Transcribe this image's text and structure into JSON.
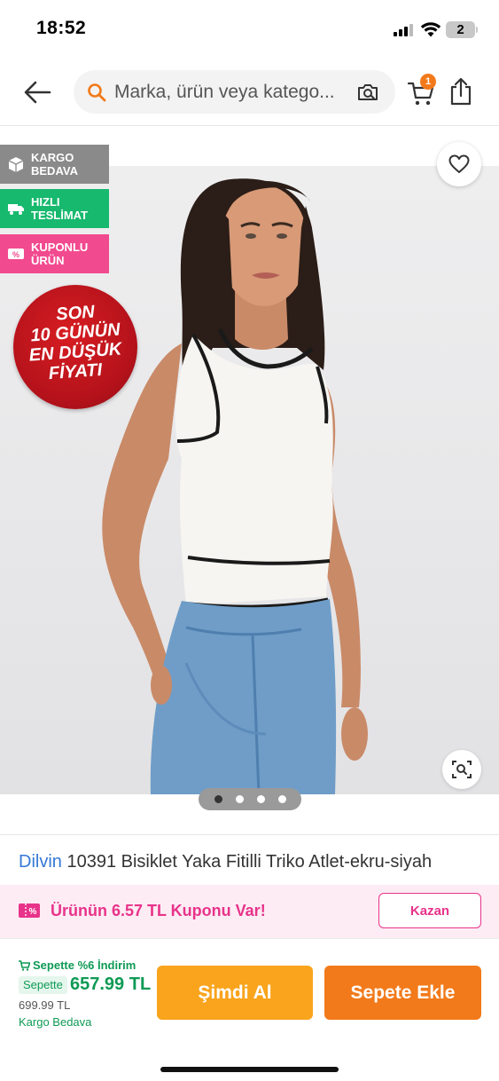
{
  "status_bar": {
    "time": "18:52",
    "battery": "2"
  },
  "header": {
    "search_placeholder": "Marka, ürün veya katego...",
    "cart_count": "1",
    "icons": {
      "back": "back-arrow-icon",
      "search": "search-icon",
      "camera": "camera-search-icon",
      "cart": "cart-icon",
      "share": "share-icon"
    }
  },
  "product_image": {
    "badges": [
      {
        "label_line1": "KARGO",
        "label_line2": "BEDAVA",
        "icon": "box-icon",
        "color": "#8a8a8a"
      },
      {
        "label_line1": "HIZLI",
        "label_line2": "TESLİMAT",
        "icon": "truck-icon",
        "color": "#17b96e"
      },
      {
        "label_line1": "KUPONLU",
        "label_line2": "ÜRÜN",
        "icon": "coupon-icon",
        "color": "#f24a8f"
      }
    ],
    "promo_seal": {
      "line1": "SON",
      "line2": "10 GÜNÜN",
      "line3": "EN DÜŞÜK",
      "line4": "FİYATI"
    },
    "page_count": 4,
    "active_page": 1
  },
  "product": {
    "brand": "Dilvin",
    "name": "10391 Bisiklet Yaka Fitilli Triko Atlet-ekru-siyah"
  },
  "coupon": {
    "text": "Ürünün 6.57 TL Kuponu Var!",
    "button": "Kazan"
  },
  "purchase": {
    "basket_discount": "Sepette %6 İndirim",
    "sepette_label": "Sepette",
    "price": "657.99 TL",
    "old_price": "699.99 TL",
    "shipping": "Kargo Bedava",
    "buy_now": "Şimdi Al",
    "add_to_cart": "Sepete Ekle"
  },
  "colors": {
    "accent_orange": "#f27a1a",
    "buy_yellow": "#f9a41c",
    "green": "#0e9a55",
    "pink": "#e8338a",
    "brand_blue": "#3479d6"
  }
}
